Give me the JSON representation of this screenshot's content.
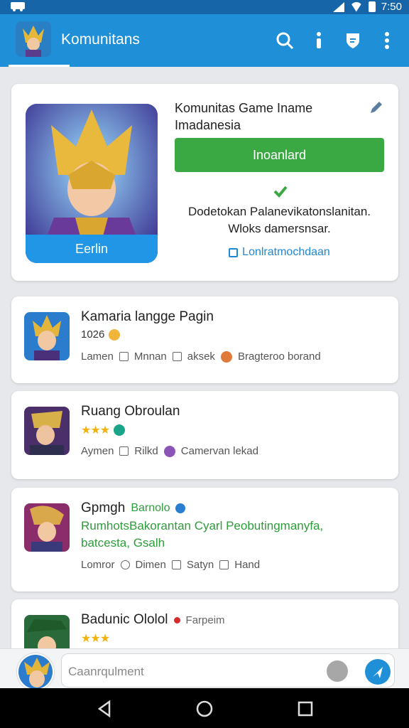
{
  "status_bar": {
    "time": "7:50"
  },
  "app_bar": {
    "title": "Komunitans",
    "icons": [
      "search-icon",
      "more-info-icon",
      "shield-icon",
      "overflow-menu-icon"
    ]
  },
  "profile": {
    "name": "Komunitas Game Iname Imadanesia",
    "avatar_chip": "Eerlin",
    "primary_button": "Inoanlard",
    "description": "Dodetokan Palanevikatonslanitan. Wloks damersnsar.",
    "link": "Lonlratmochdaan"
  },
  "posts": [
    {
      "title": "Kamaria langge Pagin",
      "subtitle": "1026",
      "actions": [
        "Lamen",
        "Mnnan",
        "aksek",
        "Bragteroo borand"
      ]
    },
    {
      "title": "Ruang Obroulan",
      "subtitle": "",
      "actions": [
        "Aymen",
        "Rilkd",
        "Camervan lekad"
      ]
    },
    {
      "title": "Gpmgh",
      "tag": "Barnolo",
      "body": "RumhotsBakorantan Cyarl Peobutingmanyfa, batcesta, Gsalh",
      "actions": [
        "Lomror",
        "Dimen",
        "Satyn",
        "Hand"
      ]
    },
    {
      "title": "Badunic Ololol",
      "tag": "Farpeim",
      "subtitle": ""
    }
  ],
  "composer": {
    "placeholder": "Caanrqulment"
  },
  "colors": {
    "primary": "#1f8fd8",
    "statusbar": "#1565a8",
    "accent_green": "#3aa843",
    "link": "#1e88d2"
  }
}
